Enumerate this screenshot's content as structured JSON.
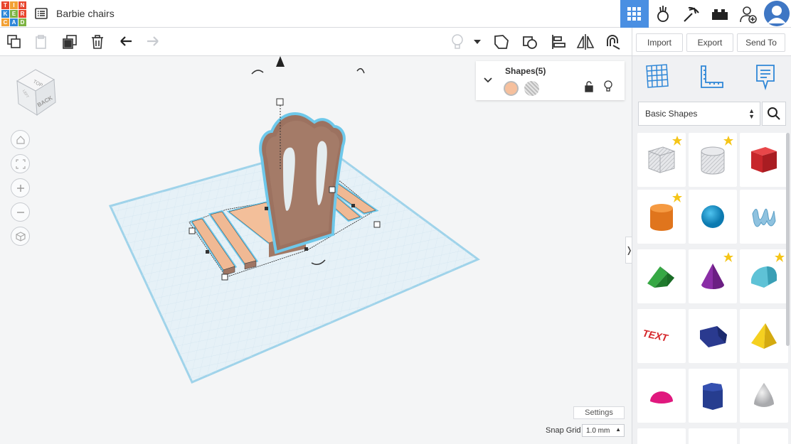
{
  "app": {
    "logo_letters": [
      "T",
      "I",
      "N",
      "K",
      "E",
      "R",
      "C",
      "A",
      "D"
    ],
    "logo_colors": [
      "#e8462e",
      "#f2a135",
      "#e8462e",
      "#2f87d7",
      "#7cb342",
      "#e8462e",
      "#f2a135",
      "#2f87d7",
      "#7cb342"
    ],
    "document_title": "Barbie chairs",
    "accent": "#4a8fe2"
  },
  "top_icons": [
    "3d-design-grid-icon",
    "circuits-icon",
    "codeblocks-icon",
    "lego-bricks-icon",
    "add-user-icon",
    "user-avatar"
  ],
  "toolbar": {
    "left_tools": [
      "copy-icon",
      "paste-icon",
      "duplicate-icon",
      "delete-icon",
      "undo-icon",
      "redo-icon"
    ],
    "right_tools": [
      "light-bulb-icon",
      "dropdown-icon",
      "note-icon",
      "shape-outline-icon",
      "align-icon",
      "mirror-icon",
      "magnet-icon"
    ],
    "actions": [
      "Import",
      "Export",
      "Send To"
    ]
  },
  "viewcube": {
    "top": "TOP",
    "back": "BACK",
    "left": "LEFT"
  },
  "shapes_panel": {
    "title": "Shapes(5)",
    "solid_color": "#f6c09d",
    "hole_color": "#b8b8b8"
  },
  "workspace": {
    "settings_label": "Settings",
    "snap_grid_label": "Snap Grid",
    "snap_grid_value": "1.0 mm"
  },
  "sidebar": {
    "panel_icons": [
      "workplane-icon",
      "ruler-icon",
      "notes-icon"
    ],
    "library": "Basic Shapes",
    "shapes": [
      {
        "name": "box-hole",
        "starred": true
      },
      {
        "name": "cylinder-hole",
        "starred": true
      },
      {
        "name": "box",
        "starred": false
      },
      {
        "name": "cylinder",
        "starred": true
      },
      {
        "name": "sphere",
        "starred": false
      },
      {
        "name": "scribble",
        "starred": false
      },
      {
        "name": "roof",
        "starred": false
      },
      {
        "name": "cone",
        "starred": true
      },
      {
        "name": "round-roof",
        "starred": true
      },
      {
        "name": "text",
        "starred": false
      },
      {
        "name": "polygon",
        "starred": false
      },
      {
        "name": "pyramid",
        "starred": false
      },
      {
        "name": "half-sphere",
        "starred": false
      },
      {
        "name": "hexagonal-prism",
        "starred": false
      },
      {
        "name": "paraboloid",
        "starred": false
      }
    ]
  }
}
